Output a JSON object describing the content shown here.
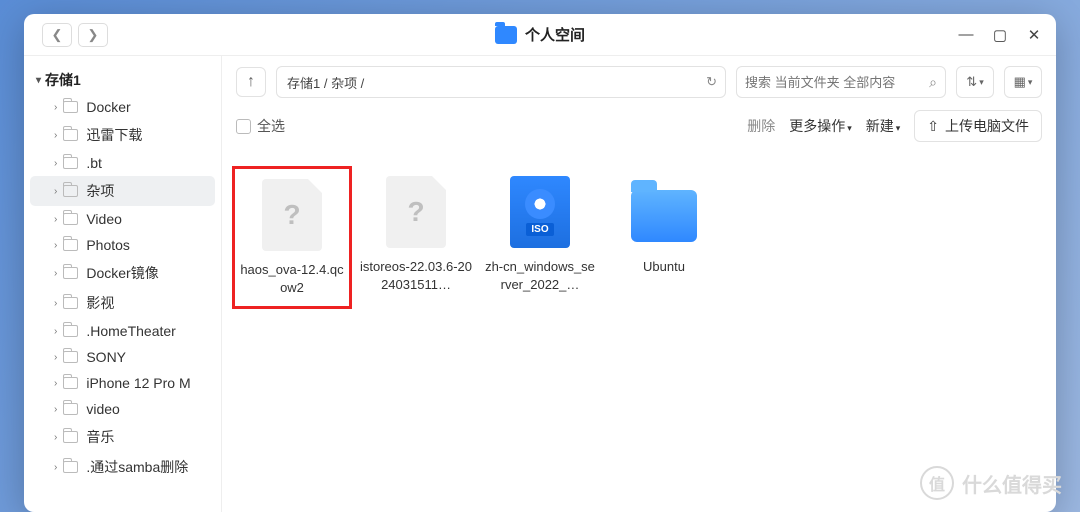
{
  "titlebar": {
    "title": "个人空间"
  },
  "sidebar": {
    "root": "存储1",
    "items": [
      {
        "label": "Docker"
      },
      {
        "label": "迅雷下载"
      },
      {
        "label": ".bt"
      },
      {
        "label": "杂项",
        "selected": true
      },
      {
        "label": "Video"
      },
      {
        "label": "Photos"
      },
      {
        "label": "Docker镜像"
      },
      {
        "label": "影视"
      },
      {
        "label": ".HomeTheater"
      },
      {
        "label": "SONY"
      },
      {
        "label": "iPhone 12 Pro M"
      },
      {
        "label": "video"
      },
      {
        "label": "音乐"
      },
      {
        "label": ".通过samba删除"
      }
    ]
  },
  "toolbar": {
    "breadcrumb": "存储1 / 杂项 /",
    "search_placeholder": "搜索 当前文件夹 全部内容",
    "select_all": "全选",
    "delete": "删除",
    "more_actions": "更多操作",
    "new": "新建",
    "upload": "上传电脑文件"
  },
  "files": [
    {
      "name": "haos_ova-12.4.qcow2",
      "kind": "unknown",
      "highlighted": true
    },
    {
      "name": "istoreos-22.03.6-2024031511…",
      "kind": "unknown"
    },
    {
      "name": "zh-cn_windows_server_2022_…",
      "kind": "iso",
      "iso_label": "ISO"
    },
    {
      "name": "Ubuntu",
      "kind": "folder"
    }
  ],
  "watermark": {
    "badge": "值",
    "text": "什么值得买"
  }
}
